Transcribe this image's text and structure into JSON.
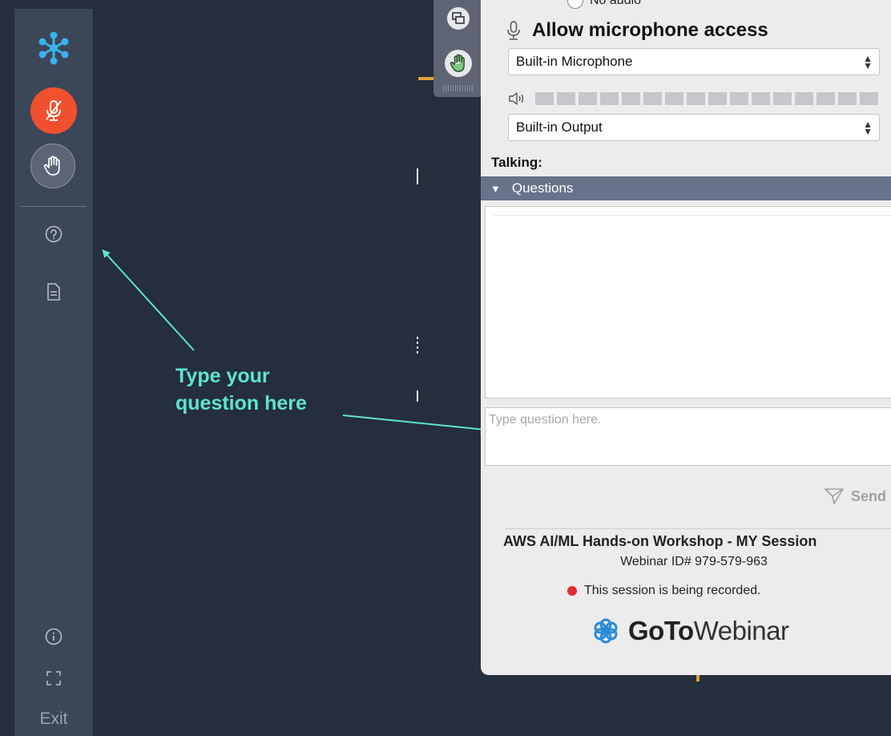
{
  "sidebar": {
    "exit_label": "Exit"
  },
  "annotation": {
    "line1": "Type your",
    "line2": "question here"
  },
  "panel": {
    "audio_option_label": "No audio",
    "mic_access_title": "Allow microphone access",
    "microphone_select_value": "Built-in Microphone",
    "output_select_value": "Built-in Output",
    "talking_label": "Talking:",
    "questions_header": "Questions",
    "question_placeholder": "Type question here.",
    "send_label": "Send",
    "session_title": "AWS AI/ML Hands-on Workshop - MY Session",
    "webinar_id": "Webinar ID# 979-579-963",
    "recording_notice": "This session is being recorded.",
    "brand_go": "GoTo",
    "brand_webinar": "Webinar"
  },
  "colors": {
    "background": "#242e3d",
    "sidebar": "#3b4659",
    "mute_button": "#f0502e",
    "annotation": "#5ee3d2",
    "questions_header": "#67738a",
    "recording_dot": "#e02c2c",
    "brand_logo": "#2a8bd6"
  },
  "icons": {
    "sidebar_logo": "snowflake-logo-icon",
    "mute": "mic-muted-icon",
    "raise_hand": "hand-icon",
    "help": "question-icon",
    "handouts": "document-icon",
    "info": "info-icon",
    "expand": "expand-icon",
    "screen": "screen-share-icon",
    "mic": "microphone-icon",
    "speaker": "speaker-icon",
    "send": "paper-plane-icon"
  }
}
